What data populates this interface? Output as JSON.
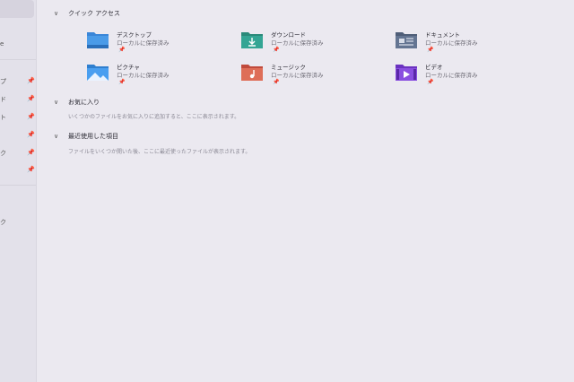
{
  "sidebar": {
    "items": [
      {
        "label": "e",
        "pin": false
      },
      {
        "label": "プ",
        "pin": true
      },
      {
        "label": "ド",
        "pin": true
      },
      {
        "label": "ト",
        "pin": true
      },
      {
        "label": "",
        "pin": true
      },
      {
        "label": "ク",
        "pin": true
      },
      {
        "label": "",
        "pin": true
      },
      {
        "label": "ク",
        "pin": false
      }
    ],
    "pin_glyph": "📌"
  },
  "quick_access": {
    "title": "クイック アクセス",
    "items": [
      {
        "name": "デスクトップ",
        "sub": "ローカルに保存済み",
        "icon": "desktop-folder-icon",
        "color": "#3a86d8"
      },
      {
        "name": "ダウンロード",
        "sub": "ローカルに保存済み",
        "icon": "downloads-folder-icon",
        "color": "#2e9e8c"
      },
      {
        "name": "ドキュメント",
        "sub": "ローカルに保存済み",
        "icon": "documents-folder-icon",
        "color": "#5a6b85"
      },
      {
        "name": "ピクチャ",
        "sub": "ローカルに保存済み",
        "icon": "pictures-folder-icon",
        "color": "#3d8fe0"
      },
      {
        "name": "ミュージック",
        "sub": "ローカルに保存済み",
        "icon": "music-folder-icon",
        "color": "#d65a4a"
      },
      {
        "name": "ビデオ",
        "sub": "ローカルに保存済み",
        "icon": "videos-folder-icon",
        "color": "#7a3fd0"
      }
    ]
  },
  "favorites": {
    "title": "お気に入り",
    "note": "いくつかのファイルをお気に入りに追加すると、ここに表示されます。"
  },
  "recent": {
    "title": "最近使用した項目",
    "note": "ファイルをいくつか開いた後、ここに最近使ったファイルが表示されます。"
  }
}
